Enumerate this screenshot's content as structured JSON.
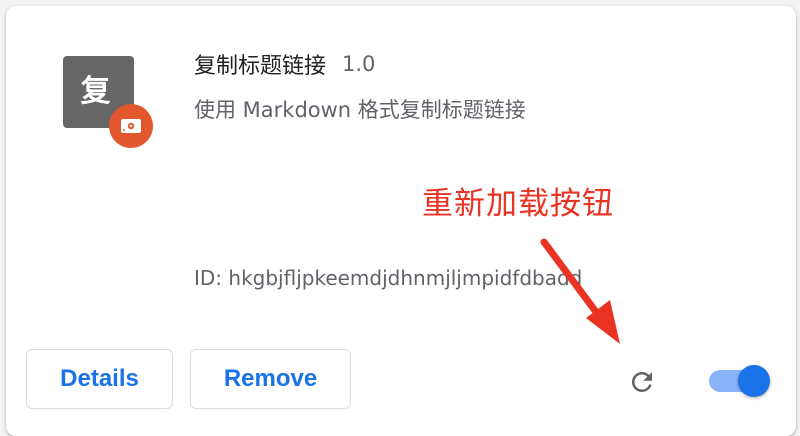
{
  "extension": {
    "icon_text": "复",
    "name": "复制标题链接",
    "version": "1.0",
    "description": "使用 Markdown 格式复制标题链接",
    "id_line": "ID: hkgbjfljpkeemdjdhnmjljmpidfdbadd",
    "enabled": true
  },
  "annotation": {
    "label": "重新加载按钮",
    "color": "#ea3323"
  },
  "actions": {
    "details_label": "Details",
    "remove_label": "Remove",
    "reload_icon": "reload-icon"
  },
  "colors": {
    "accent": "#1a73e8",
    "toggle_track": "#8ab4f8",
    "icon_bg": "#666666",
    "badge_bg": "#e2572d"
  }
}
